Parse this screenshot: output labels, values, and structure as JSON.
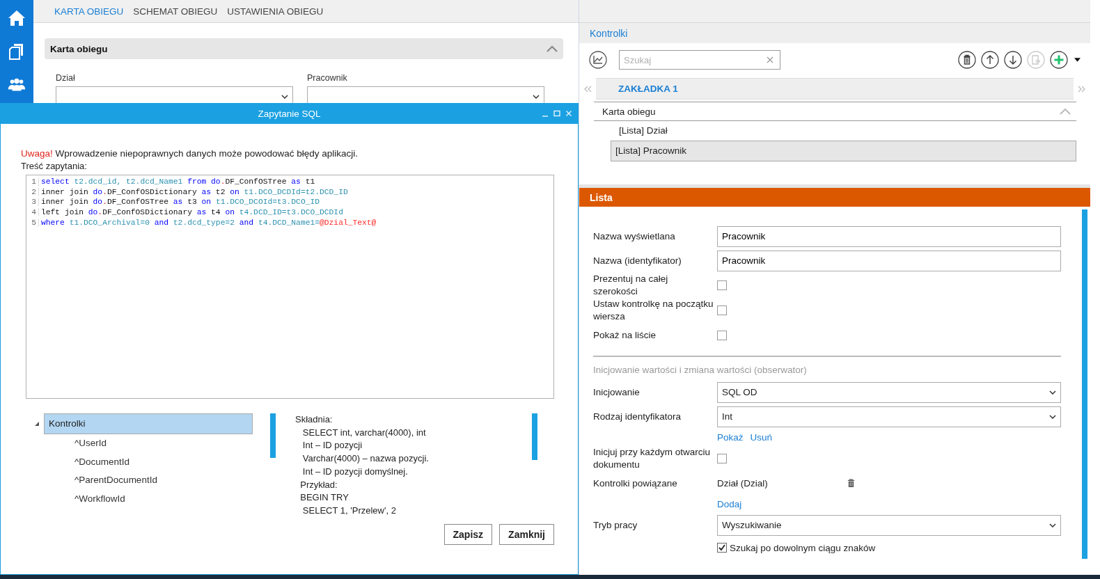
{
  "nav_tabs": [
    {
      "label": "KARTA OBIEGU",
      "selected": true
    },
    {
      "label": "SCHEMAT OBIEGU",
      "selected": false
    },
    {
      "label": "USTAWIENIA OBIEGU",
      "selected": false
    }
  ],
  "form_section": {
    "title": "Karta obiegu",
    "expanded": true,
    "fields": [
      {
        "label": "Dział"
      },
      {
        "label": "Pracownik"
      }
    ]
  },
  "dialog": {
    "title": "Zapytanie SQL",
    "warning": {
      "lead": "Uwaga!",
      "text": "Wprowadzenie niepoprawnych danych może powodować błędy aplikacji."
    },
    "query_label": "Treść zapytania:",
    "code_lines": [
      {
        "number": "1",
        "tokens": [
          {
            "kind": "keyword",
            "t": "select "
          },
          {
            "kind": "column",
            "t": "t2.dcd_id, t2.dcd_Name1 "
          },
          {
            "kind": "keyword",
            "t": "from "
          },
          {
            "kind": "keyword",
            "t": "do"
          },
          {
            "kind": "punct",
            "t": "."
          },
          {
            "kind": "plain",
            "t": "DF_ConfOSTree "
          },
          {
            "kind": "keyword",
            "t": "as "
          },
          {
            "kind": "plain",
            "t": "t1"
          }
        ]
      },
      {
        "number": "2",
        "tokens": [
          {
            "kind": "plain",
            "t": "inner join "
          },
          {
            "kind": "keyword",
            "t": "do"
          },
          {
            "kind": "punct",
            "t": "."
          },
          {
            "kind": "plain",
            "t": "DF_ConfOSDictionary "
          },
          {
            "kind": "keyword",
            "t": "as "
          },
          {
            "kind": "plain",
            "t": "t2 "
          },
          {
            "kind": "keyword",
            "t": "on "
          },
          {
            "kind": "column",
            "t": "t1.DCO_DCDId=t2.DCD_ID"
          }
        ]
      },
      {
        "number": "3",
        "tokens": [
          {
            "kind": "plain",
            "t": "inner join "
          },
          {
            "kind": "keyword",
            "t": "do"
          },
          {
            "kind": "punct",
            "t": "."
          },
          {
            "kind": "plain",
            "t": "DF_ConfOSTree "
          },
          {
            "kind": "keyword",
            "t": "as "
          },
          {
            "kind": "plain",
            "t": "t3 "
          },
          {
            "kind": "keyword",
            "t": "on "
          },
          {
            "kind": "column",
            "t": "t1.DCO_DCOId=t3.DCO_ID"
          }
        ]
      },
      {
        "number": "4",
        "tokens": [
          {
            "kind": "plain",
            "t": "left join "
          },
          {
            "kind": "keyword",
            "t": "do"
          },
          {
            "kind": "punct",
            "t": "."
          },
          {
            "kind": "plain",
            "t": "DF_ConfOSDictionary "
          },
          {
            "kind": "keyword",
            "t": "as "
          },
          {
            "kind": "plain",
            "t": "t4 "
          },
          {
            "kind": "keyword",
            "t": "on "
          },
          {
            "kind": "column",
            "t": "t4.DCD_ID=t3.DCO_DCDId"
          }
        ]
      },
      {
        "number": "5",
        "tokens": [
          {
            "kind": "keyword",
            "t": "where "
          },
          {
            "kind": "column",
            "t": "t1.DCO_Archival=0 "
          },
          {
            "kind": "keyword",
            "t": "and "
          },
          {
            "kind": "column",
            "t": "t2.dcd_type=2 "
          },
          {
            "kind": "keyword",
            "t": "and "
          },
          {
            "kind": "column",
            "t": "t4.DCD_Name1="
          },
          {
            "kind": "variable",
            "t": "@Dzial_Text@"
          }
        ]
      }
    ],
    "tree": {
      "label": "Kontrolki",
      "expanded": true,
      "selected": true,
      "children": [
        {
          "label": "^UserId"
        },
        {
          "label": "^DocumentId"
        },
        {
          "label": "^ParentDocumentId"
        },
        {
          "label": "^WorkflowId"
        }
      ]
    },
    "syntax_text": "Składnia:\n   SELECT int, varchar(4000), int\n   Int – ID pozycji\n   Varchar(4000) – nazwa pozycji.\n   Int – ID pozycji domyślnej.\n  Przykład:\n  BEGIN TRY\n   SELECT 1, 'Przelew', 2",
    "buttons": [
      "Zapisz",
      "Zamknij"
    ]
  },
  "controls_panel": {
    "title": "Kontrolki",
    "search": {
      "placeholder": "Szukaj"
    },
    "toolbar": [
      {
        "kind": "delete",
        "disabled": false
      },
      {
        "kind": "up",
        "disabled": false
      },
      {
        "kind": "down",
        "disabled": false
      },
      {
        "kind": "copy",
        "disabled": true
      },
      {
        "kind": "add",
        "disabled": false
      }
    ],
    "tab": "ZAKŁADKA 1",
    "group": {
      "label": "Karta obiegu",
      "expanded": true,
      "children": [
        {
          "label": "[Lista] Dział",
          "selected": false
        },
        {
          "label": "[Lista] Pracownik",
          "selected": true
        }
      ]
    }
  },
  "properties": {
    "title": "Lista",
    "rows": [
      {
        "kind": "text",
        "label": "Nazwa wyświetlana",
        "value": "Pracownik"
      },
      {
        "kind": "text",
        "label": "Nazwa (identyfikator)",
        "value": "Pracownik"
      },
      {
        "kind": "checkbox",
        "label": "Prezentuj na całej szerokości",
        "checked": false
      },
      {
        "kind": "checkbox",
        "label": "Ustaw kontrolkę na początku wiersza",
        "checked": false
      },
      {
        "kind": "checkbox",
        "label": "Pokaż na liście",
        "checked": false
      },
      {
        "kind": "section",
        "label": "Inicjowanie wartości i zmiana wartości (obserwator)"
      },
      {
        "kind": "select",
        "label": "Inicjowanie",
        "value": "SQL OD"
      },
      {
        "kind": "select",
        "label": "Rodzaj identyfikatora",
        "value": "Int"
      },
      {
        "kind": "links",
        "links": [
          "Pokaż",
          "Usuń"
        ]
      },
      {
        "kind": "checkbox",
        "label": "Inicjuj przy każdym otwarciu dokumentu",
        "checked": false
      },
      {
        "kind": "linked",
        "label": "Kontrolki powiązane",
        "value": "Dział (Dzial)"
      },
      {
        "kind": "links",
        "links": [
          "Dodaj"
        ]
      },
      {
        "kind": "select",
        "label": "Tryb pracy",
        "value": "Wyszukiwanie"
      },
      {
        "kind": "option",
        "label": "Szukaj po dowolnym ciągu znaków",
        "checked": true
      }
    ]
  }
}
